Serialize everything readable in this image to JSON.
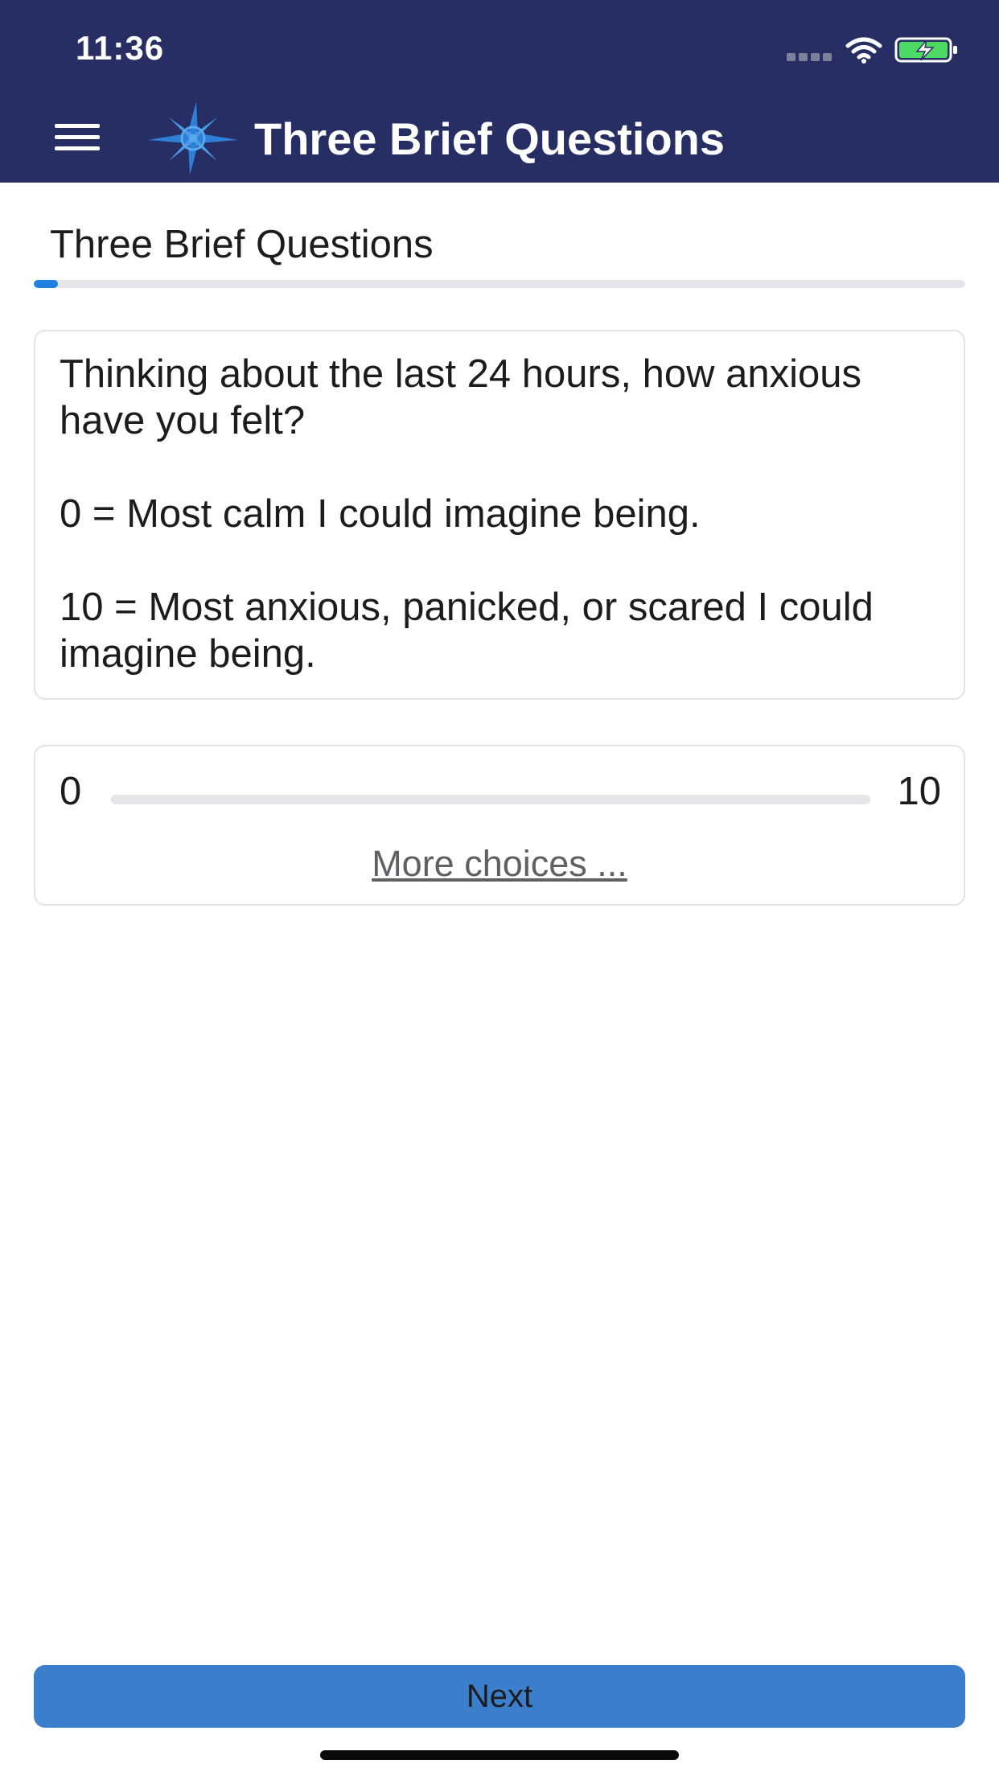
{
  "status_bar": {
    "time": "11:36"
  },
  "header": {
    "title": "Three Brief Questions"
  },
  "survey": {
    "title": "Three Brief Questions",
    "progress_percent": 2.6
  },
  "question": {
    "lines": [
      "Thinking about the last 24 hours, how anxious have you felt?",
      "0 = Most calm I could imagine being.",
      "10 = Most anxious, panicked, or scared I could imagine being."
    ]
  },
  "slider": {
    "min_label": "0",
    "max_label": "10",
    "more_choices": "More choices ..."
  },
  "footer": {
    "next_label": "Next"
  },
  "colors": {
    "header_bg": "#262e63",
    "accent": "#1f80e0",
    "button": "#3b7fcc"
  }
}
